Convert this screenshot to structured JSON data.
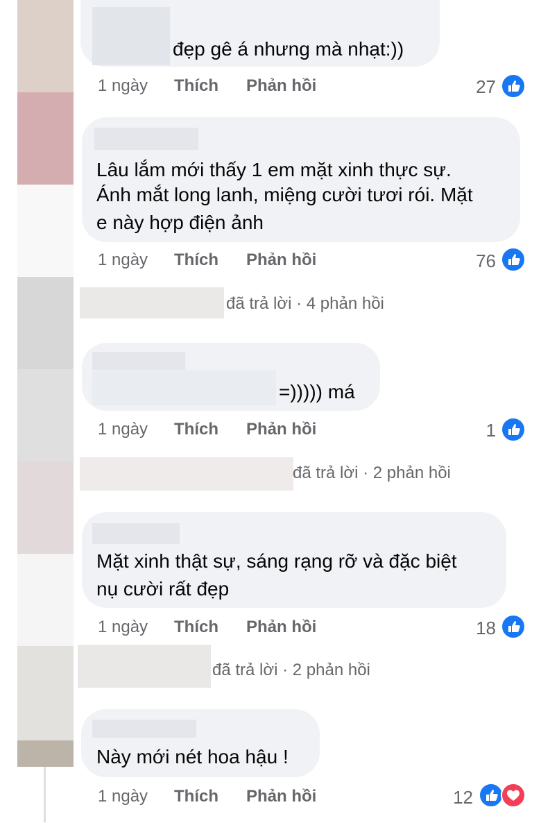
{
  "comments": [
    {
      "text_lines": [
        "đẹp gê á nhưng mà nhạt:))"
      ],
      "time": "1 ngày",
      "like_label": "Thích",
      "reply_label": "Phản hồi",
      "reaction_count": "27",
      "reactions": [
        "like-icon"
      ]
    },
    {
      "text_lines": [
        "Lâu lắm mới thấy 1 em mặt xinh thực sự.",
        "Ánh mắt long lanh, miệng cười tươi rói. Mặt",
        "e này hợp điện ảnh"
      ],
      "time": "1 ngày",
      "like_label": "Thích",
      "reply_label": "Phản hồi",
      "reaction_count": "76",
      "reactions": [
        "like-icon"
      ],
      "replies_summary": "đã trả lời · 4 phản hồi"
    },
    {
      "text_lines": [
        "=))))) má"
      ],
      "time": "1 ngày",
      "like_label": "Thích",
      "reply_label": "Phản hồi",
      "reaction_count": "1",
      "reactions": [
        "like-icon"
      ],
      "replies_summary": "đã trả lời · 2 phản hồi"
    },
    {
      "text_lines": [
        "Mặt xinh thật sự, sáng rạng rỡ và đặc biệt",
        "nụ cười rất đẹp"
      ],
      "time": "1 ngày",
      "like_label": "Thích",
      "reply_label": "Phản hồi",
      "reaction_count": "18",
      "reactions": [
        "like-icon"
      ],
      "replies_summary": "đã trả lời · 2 phản hồi"
    },
    {
      "text_lines": [
        "Này mới nét hoa hậu !"
      ],
      "time": "1 ngày",
      "like_label": "Thích",
      "reply_label": "Phản hồi",
      "reaction_count": "12",
      "reactions": [
        "like-icon",
        "heart-icon"
      ]
    }
  ],
  "colors": {
    "bubble": "#f0f2f5",
    "meta_text": "#65676b",
    "like_blue": "#1877f2",
    "love_red": "#f33e58"
  }
}
